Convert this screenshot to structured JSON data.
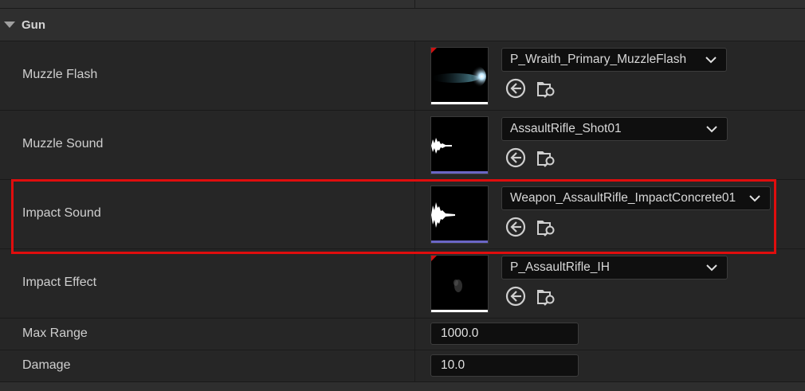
{
  "category": {
    "title": "Gun"
  },
  "properties": {
    "muzzle_flash": {
      "label": "Muzzle Flash",
      "asset": "P_Wraith_Primary_MuzzleFlash"
    },
    "muzzle_sound": {
      "label": "Muzzle Sound",
      "asset": "AssaultRifle_Shot01"
    },
    "impact_sound": {
      "label": "Impact Sound",
      "asset": "Weapon_AssaultRifle_ImpactConcrete01"
    },
    "impact_effect": {
      "label": "Impact Effect",
      "asset": "P_AssaultRifle_IH"
    },
    "max_range": {
      "label": "Max Range",
      "value": "1000.0"
    },
    "damage": {
      "label": "Damage",
      "value": "10.0"
    }
  },
  "icons": {
    "use_selected": "arrow-left-circle-icon",
    "browse": "folder-search-icon",
    "dropdown": "chevron-down-icon",
    "collapse": "triangle-down-icon"
  },
  "colors": {
    "highlight": "#e00d0d",
    "sound_bar": "#6b66c6",
    "asset_corner": "#d01010"
  }
}
